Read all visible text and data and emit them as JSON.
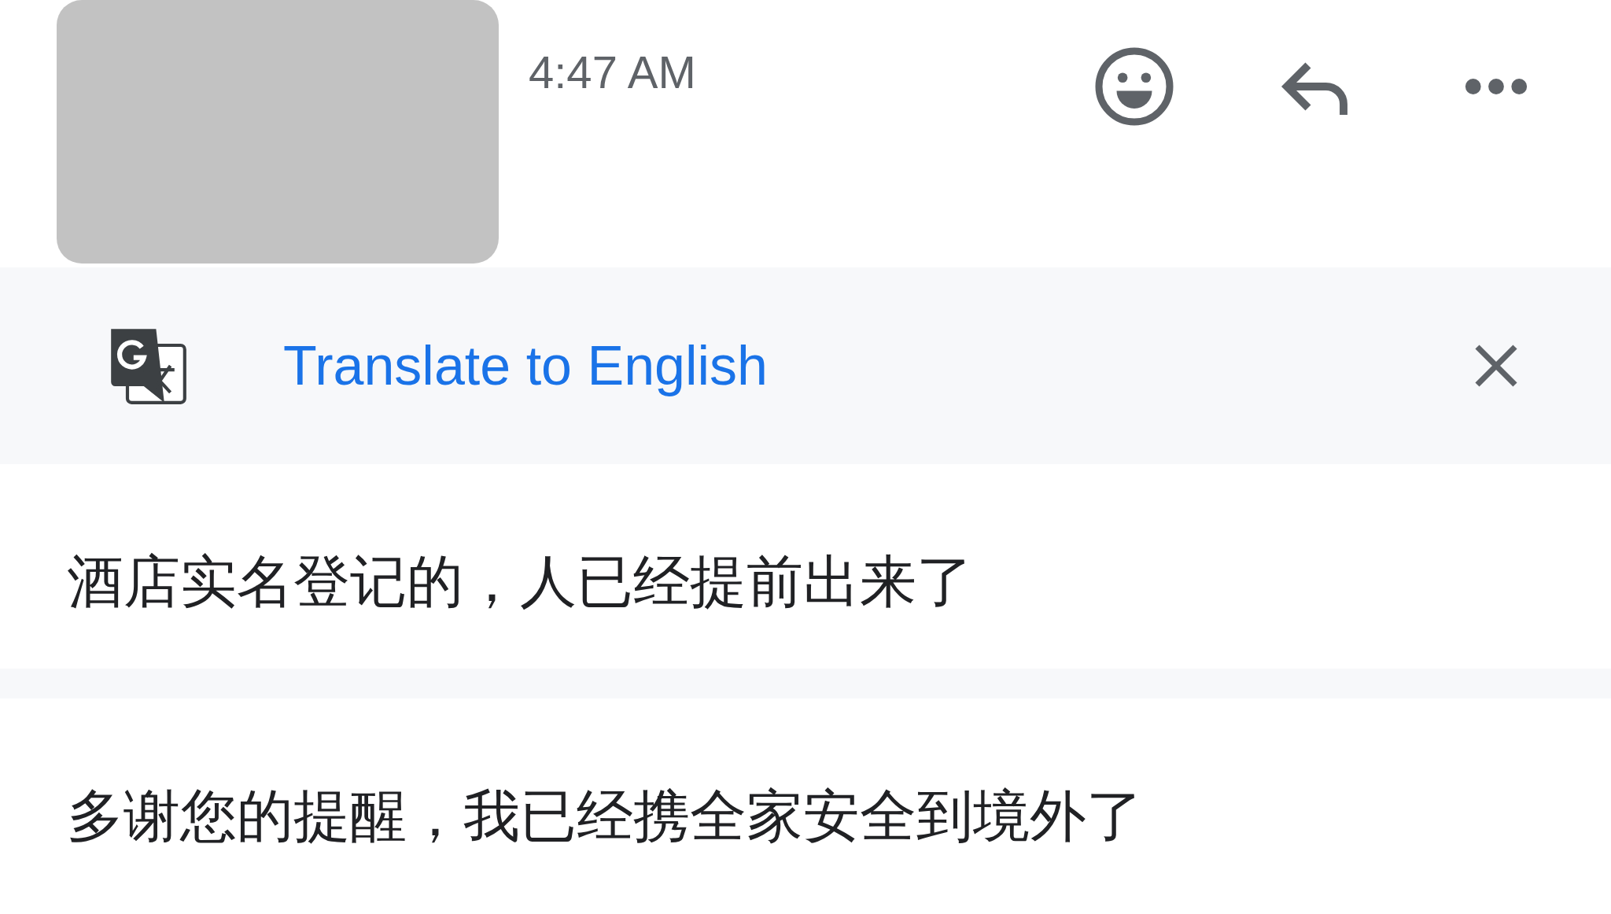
{
  "message": {
    "time": "4:47 AM"
  },
  "translate_bar": {
    "label": "Translate to English"
  },
  "messages": [
    {
      "text": "酒店实名登记的，人已经提前出来了"
    },
    {
      "text": "多谢您的提醒，我已经携全家安全到境外了"
    }
  ]
}
